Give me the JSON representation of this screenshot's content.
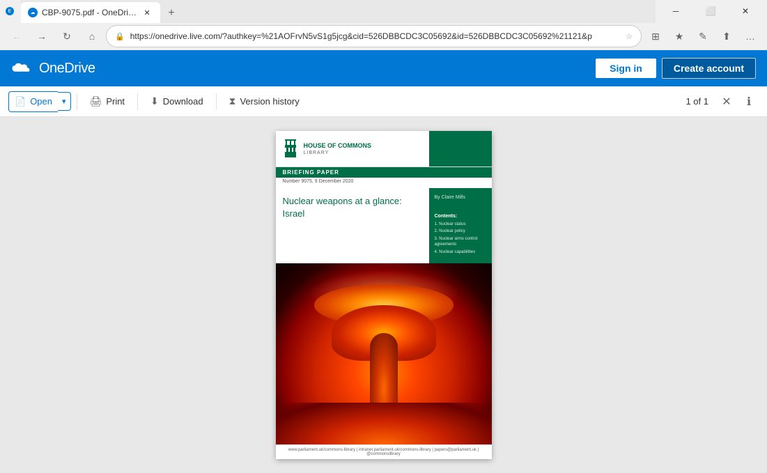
{
  "browser": {
    "tab_title": "CBP-9075.pdf - OneDri…",
    "tab_favicon": "☁",
    "new_tab_symbol": "+",
    "url": "https://onedrive.live.com/?authkey=%21AOFrvN5vS1g5jcg&cid=526DBBCDC3C05692&id=526DBBCDC3C05692%21121&p",
    "nav": {
      "back_icon": "←",
      "forward_icon": "→",
      "refresh_icon": "↻",
      "home_icon": "⌂",
      "lock_icon": "🔒",
      "favorites_icon": "★",
      "pen_icon": "✎",
      "share_icon": "⬆",
      "more_icon": "…",
      "tab_list_icon": "⊞",
      "profile_icon": "☁"
    },
    "window_controls": {
      "minimize": "─",
      "maximize": "⬜",
      "close": "✕"
    }
  },
  "onedrive": {
    "logo_text": "OneDrive",
    "sign_in_label": "Sign in",
    "create_account_label": "Create account"
  },
  "toolbar": {
    "open_label": "Open",
    "open_dropdown_icon": "▾",
    "print_label": "Print",
    "print_icon": "🖨",
    "download_label": "Download",
    "download_icon": "⬇",
    "version_history_label": "Version history",
    "version_history_icon": "⧗",
    "page_indicator": "1 of 1",
    "close_icon": "✕",
    "info_icon": "ℹ"
  },
  "document": {
    "institution": "House of Commons",
    "institution_sub": "Library",
    "type": "BRIEFING PAPER",
    "number": "Number 9075, 9 December 2020",
    "title": "Nuclear weapons at a glance: Israel",
    "author": "By Claire Mills",
    "contents_label": "Contents:",
    "contents_items": [
      "1.  Nuclear status",
      "2.  Nuclear policy",
      "3.  Nuclear arms control agreements",
      "4.  Nuclear capabilities"
    ],
    "footer_text": "www.parliament.uk/commons-library | intranet.parliament.uk/commons-library | papers@parliament.uk | @commonslibrary"
  },
  "colors": {
    "onedrive_blue": "#0078d4",
    "hoc_green": "#006e46",
    "accent_blue": "#0078d4"
  }
}
